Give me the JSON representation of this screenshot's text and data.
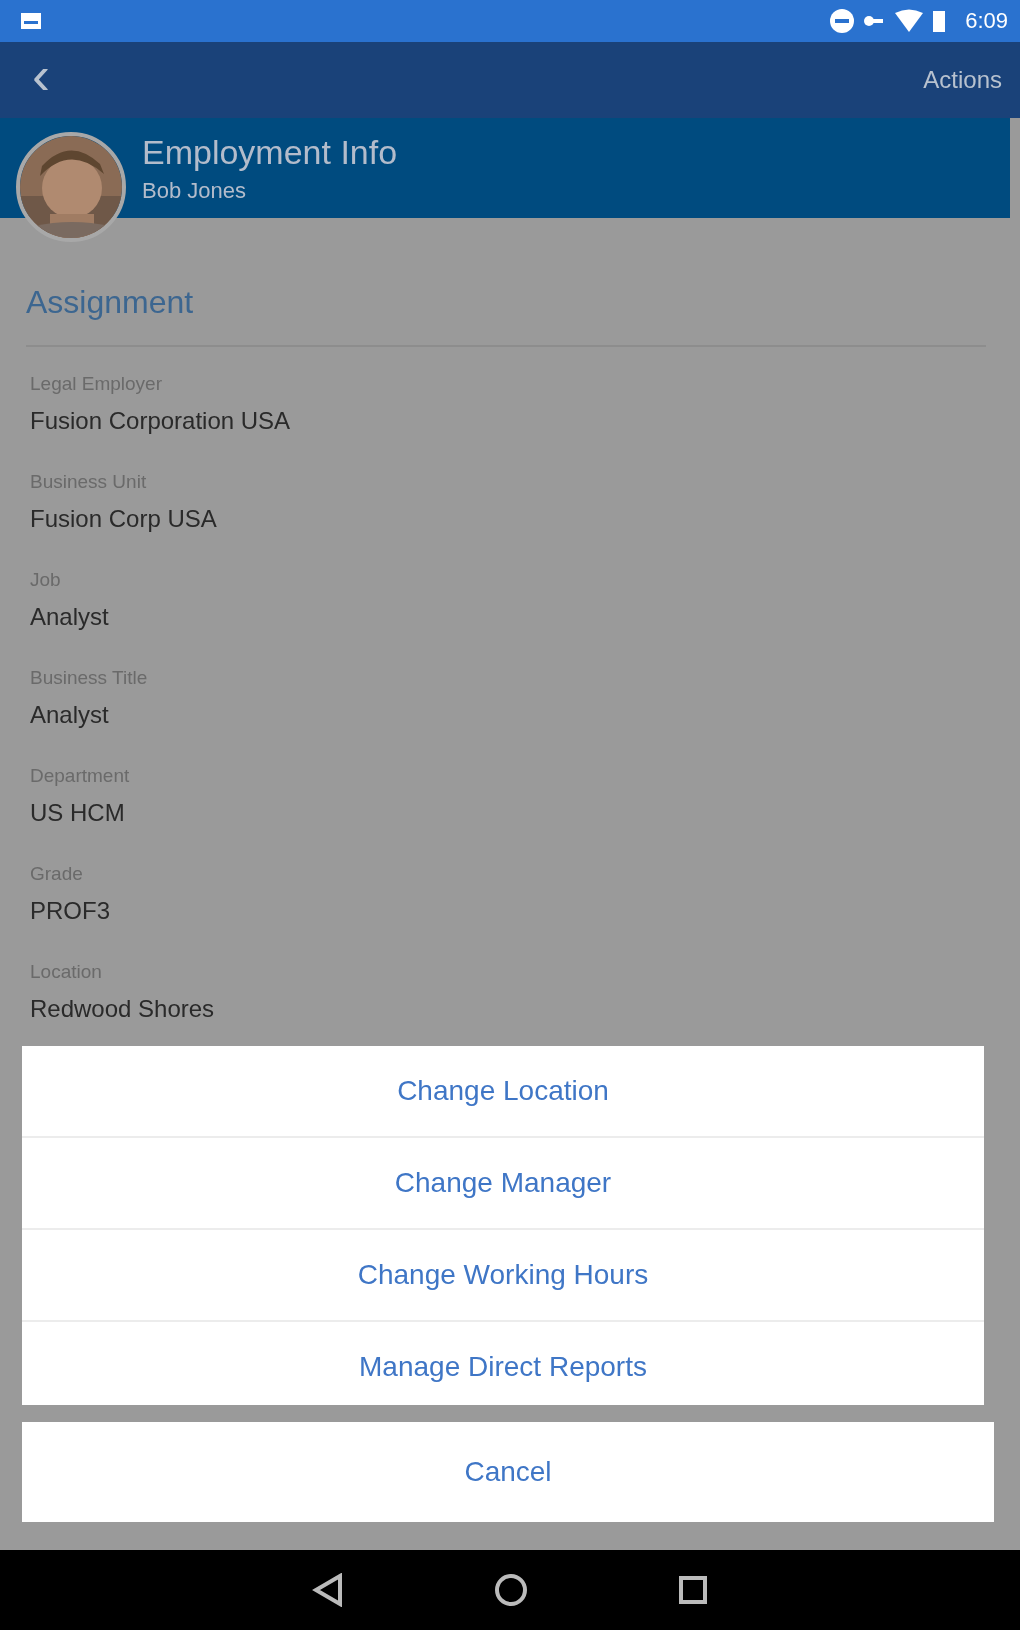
{
  "status_bar": {
    "time": "6:09"
  },
  "toolbar": {
    "back": "‹",
    "actions": "Actions"
  },
  "header": {
    "title": "Employment Info",
    "subtitle": "Bob Jones"
  },
  "section": {
    "title": "Assignment"
  },
  "fields": [
    {
      "label": "Legal Employer",
      "value": "Fusion Corporation USA"
    },
    {
      "label": "Business Unit",
      "value": "Fusion Corp USA"
    },
    {
      "label": "Job",
      "value": "Analyst"
    },
    {
      "label": "Business Title",
      "value": "Analyst"
    },
    {
      "label": "Department",
      "value": "US HCM"
    },
    {
      "label": "Grade",
      "value": "PROF3"
    },
    {
      "label": "Location",
      "value": "Redwood Shores"
    }
  ],
  "action_sheet": {
    "items": [
      "Change Location",
      "Change Manager",
      "Change Working Hours",
      "Manage Direct Reports"
    ],
    "cancel": "Cancel"
  }
}
